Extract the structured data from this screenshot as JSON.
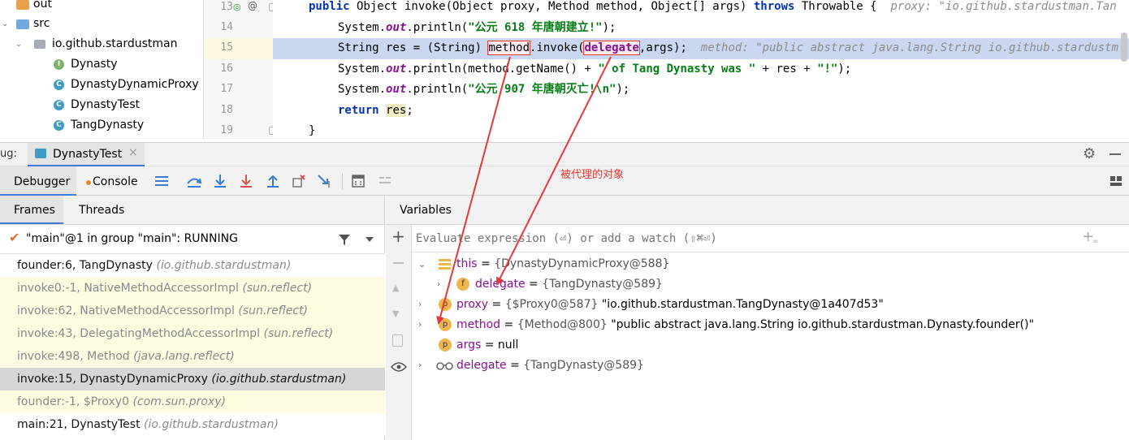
{
  "tree": {
    "items": [
      {
        "label": "out",
        "kind": "folder"
      },
      {
        "label": "src",
        "kind": "folder"
      },
      {
        "label": "io.github.stardustman",
        "kind": "package"
      },
      {
        "label": "Dynasty",
        "kind": "interface"
      },
      {
        "label": "DynastyDynamicProxy",
        "kind": "class"
      },
      {
        "label": "DynastyTest",
        "kind": "class"
      },
      {
        "label": "TangDynasty",
        "kind": "class"
      }
    ]
  },
  "editor": {
    "line_numbers": [
      "13",
      "14",
      "15",
      "16",
      "17",
      "18",
      "19"
    ],
    "line13": {
      "kw1": "public",
      "t1": " Object invoke(Object proxy, Method method, Object[] args) ",
      "kw2": "throws",
      "t2": " Throwable {",
      "hint": "proxy: \"io.github.stardustman.Tan"
    },
    "line14": {
      "t1": "System.",
      "fld": "out",
      "t2": ".println(",
      "str": "\"公元 618 年唐朝建立!\"",
      "t3": ");"
    },
    "line15": {
      "t1": "String res = (String) ",
      "method": "method",
      "t2": ".invoke(",
      "delegate": "delegate",
      "t3": ",args);",
      "hint": "method: \"public abstract java.lang.String io.github.stardustm"
    },
    "line16": {
      "t1": "System.",
      "fld": "out",
      "t2": ".println(method.getName() + ",
      "str": "\" of Tang Dynasty was \"",
      "t3": " + res + ",
      "str2": "\"!\"",
      "t4": ");"
    },
    "line17": {
      "t1": "System.",
      "fld": "out",
      "t2": ".println(",
      "str": "\"公元 907 年唐朝灭亡!\\n\"",
      "t3": ");"
    },
    "line18": {
      "kw": "return",
      "sp": " ",
      "res": "res",
      "t1": ";"
    },
    "line19": {
      "t1": "}"
    }
  },
  "debug": {
    "label": "ug:",
    "tab": "DynastyTest",
    "tab_debugger": "Debugger",
    "tab_console": "Console",
    "annotation": "被代理的对象"
  },
  "frames": {
    "tab_frames": "Frames",
    "tab_threads": "Threads",
    "thread": "\"main\"@1 in group \"main\": RUNNING",
    "items": [
      {
        "method": "founder:6, TangDynasty",
        "pkg": "(io.github.stardustman)",
        "style": "normal"
      },
      {
        "method": "invoke0:-1, NativeMethodAccessorImpl",
        "pkg": "(sun.reflect)",
        "style": "lib"
      },
      {
        "method": "invoke:62, NativeMethodAccessorImpl",
        "pkg": "(sun.reflect)",
        "style": "lib"
      },
      {
        "method": "invoke:43, DelegatingMethodAccessorImpl",
        "pkg": "(sun.reflect)",
        "style": "lib"
      },
      {
        "method": "invoke:498, Method",
        "pkg": "(java.lang.reflect)",
        "style": "lib"
      },
      {
        "method": "invoke:15, DynastyDynamicProxy",
        "pkg": "(io.github.stardustman)",
        "style": "selected"
      },
      {
        "method": "founder:-1, $Proxy0",
        "pkg": "(com.sun.proxy)",
        "style": "lib"
      },
      {
        "method": "main:21, DynastyTest",
        "pkg": "(io.github.stardustman)",
        "style": "normal"
      }
    ]
  },
  "variables": {
    "title": "Variables",
    "eval_placeholder": "Evaluate expression (⏎) or add a watch (⇧⌘⏎)",
    "items": [
      {
        "name": "this",
        "eq": " = ",
        "val": "{DynastyDynamicProxy@588}",
        "str": ""
      },
      {
        "name": "delegate",
        "eq": " = ",
        "val": "{TangDynasty@589}",
        "str": ""
      },
      {
        "name": "proxy",
        "eq": " = ",
        "val": "{$Proxy0@587} ",
        "str": "\"io.github.stardustman.TangDynasty@1a407d53\""
      },
      {
        "name": "method",
        "eq": " = ",
        "val": "{Method@800} ",
        "str": "\"public abstract java.lang.String io.github.stardustman.Dynasty.founder()\""
      },
      {
        "name": "args",
        "eq": " = ",
        "val": "",
        "str": "null"
      },
      {
        "name": "delegate",
        "eq": " = ",
        "val": "{TangDynasty@589}",
        "str": ""
      }
    ]
  },
  "colors": {
    "annotation": "#e53935",
    "selected_line": "#c9d7f0",
    "accent": "#3d7bd6"
  }
}
